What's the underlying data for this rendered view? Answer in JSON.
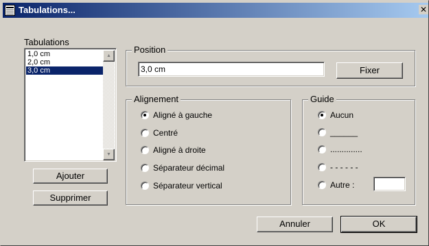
{
  "window": {
    "title": "Tabulations...",
    "close_glyph": "✕"
  },
  "tabs_list": {
    "label": "Tabulations",
    "items": [
      "1,0 cm",
      "2,0 cm",
      "3,0 cm"
    ],
    "selected": 2,
    "up_arrow": "▲",
    "down_arrow": "▼"
  },
  "buttons": {
    "add": "Ajouter",
    "remove": "Supprimer",
    "set": "Fixer",
    "cancel": "Annuler",
    "ok": "OK"
  },
  "position": {
    "title": "Position",
    "value": "3,0 cm"
  },
  "alignment": {
    "title": "Alignement",
    "options": [
      "Aligné à gauche",
      "Centré",
      "Aligné à droite",
      "Séparateur décimal",
      "Séparateur vertical"
    ],
    "selected": 0
  },
  "leader": {
    "title": "Guide",
    "options": [
      "Aucun",
      "______",
      "..............",
      "- - - - - -",
      "Autre :"
    ],
    "selected": 0,
    "other_value": ""
  },
  "colors": {
    "title_start": "#0a246a",
    "title_end": "#a6caf0",
    "face": "#d4d0c8",
    "selection": "#0a246a"
  },
  "icons": [
    "window-app-icon",
    "close-icon",
    "scroll-up-icon",
    "scroll-down-icon"
  ]
}
